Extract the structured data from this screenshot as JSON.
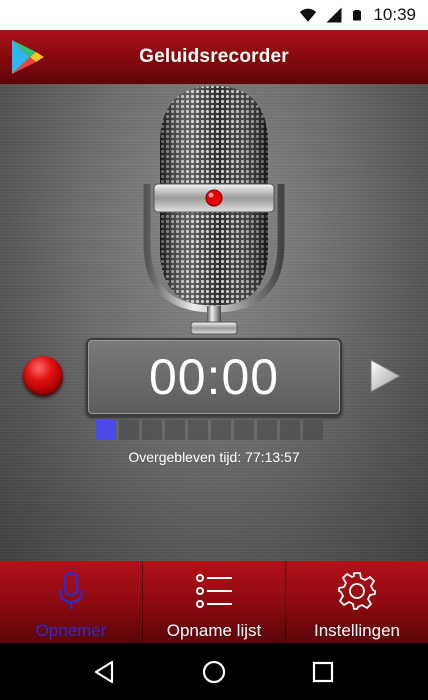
{
  "status_bar": {
    "time": "10:39",
    "icons": [
      "wifi-icon",
      "signal-icon",
      "battery-icon"
    ]
  },
  "app_bar": {
    "title": "Geluidsrecorder",
    "logo": "play-store-icon"
  },
  "recorder": {
    "timer": "00:00",
    "remaining_label": "Overgebleven tijd: 77:13:57",
    "level": 0.1,
    "record_icon": "record-icon",
    "play_icon": "play-icon",
    "mic_image": "microphone-image"
  },
  "tabs": [
    {
      "label": "Opnemer",
      "icon": "microphone-icon",
      "active": true
    },
    {
      "label": "Opname lijst",
      "icon": "list-icon",
      "active": false
    },
    {
      "label": "Instellingen",
      "icon": "gear-icon",
      "active": false
    }
  ],
  "nav": {
    "back": "back-icon",
    "home": "home-icon",
    "recents": "recents-icon"
  },
  "colors": {
    "app_bar_red": "#8a0a10",
    "active_tab_blue": "#2a2ad8",
    "level_blue": "#4a4ae8",
    "record_red": "#e01010"
  }
}
